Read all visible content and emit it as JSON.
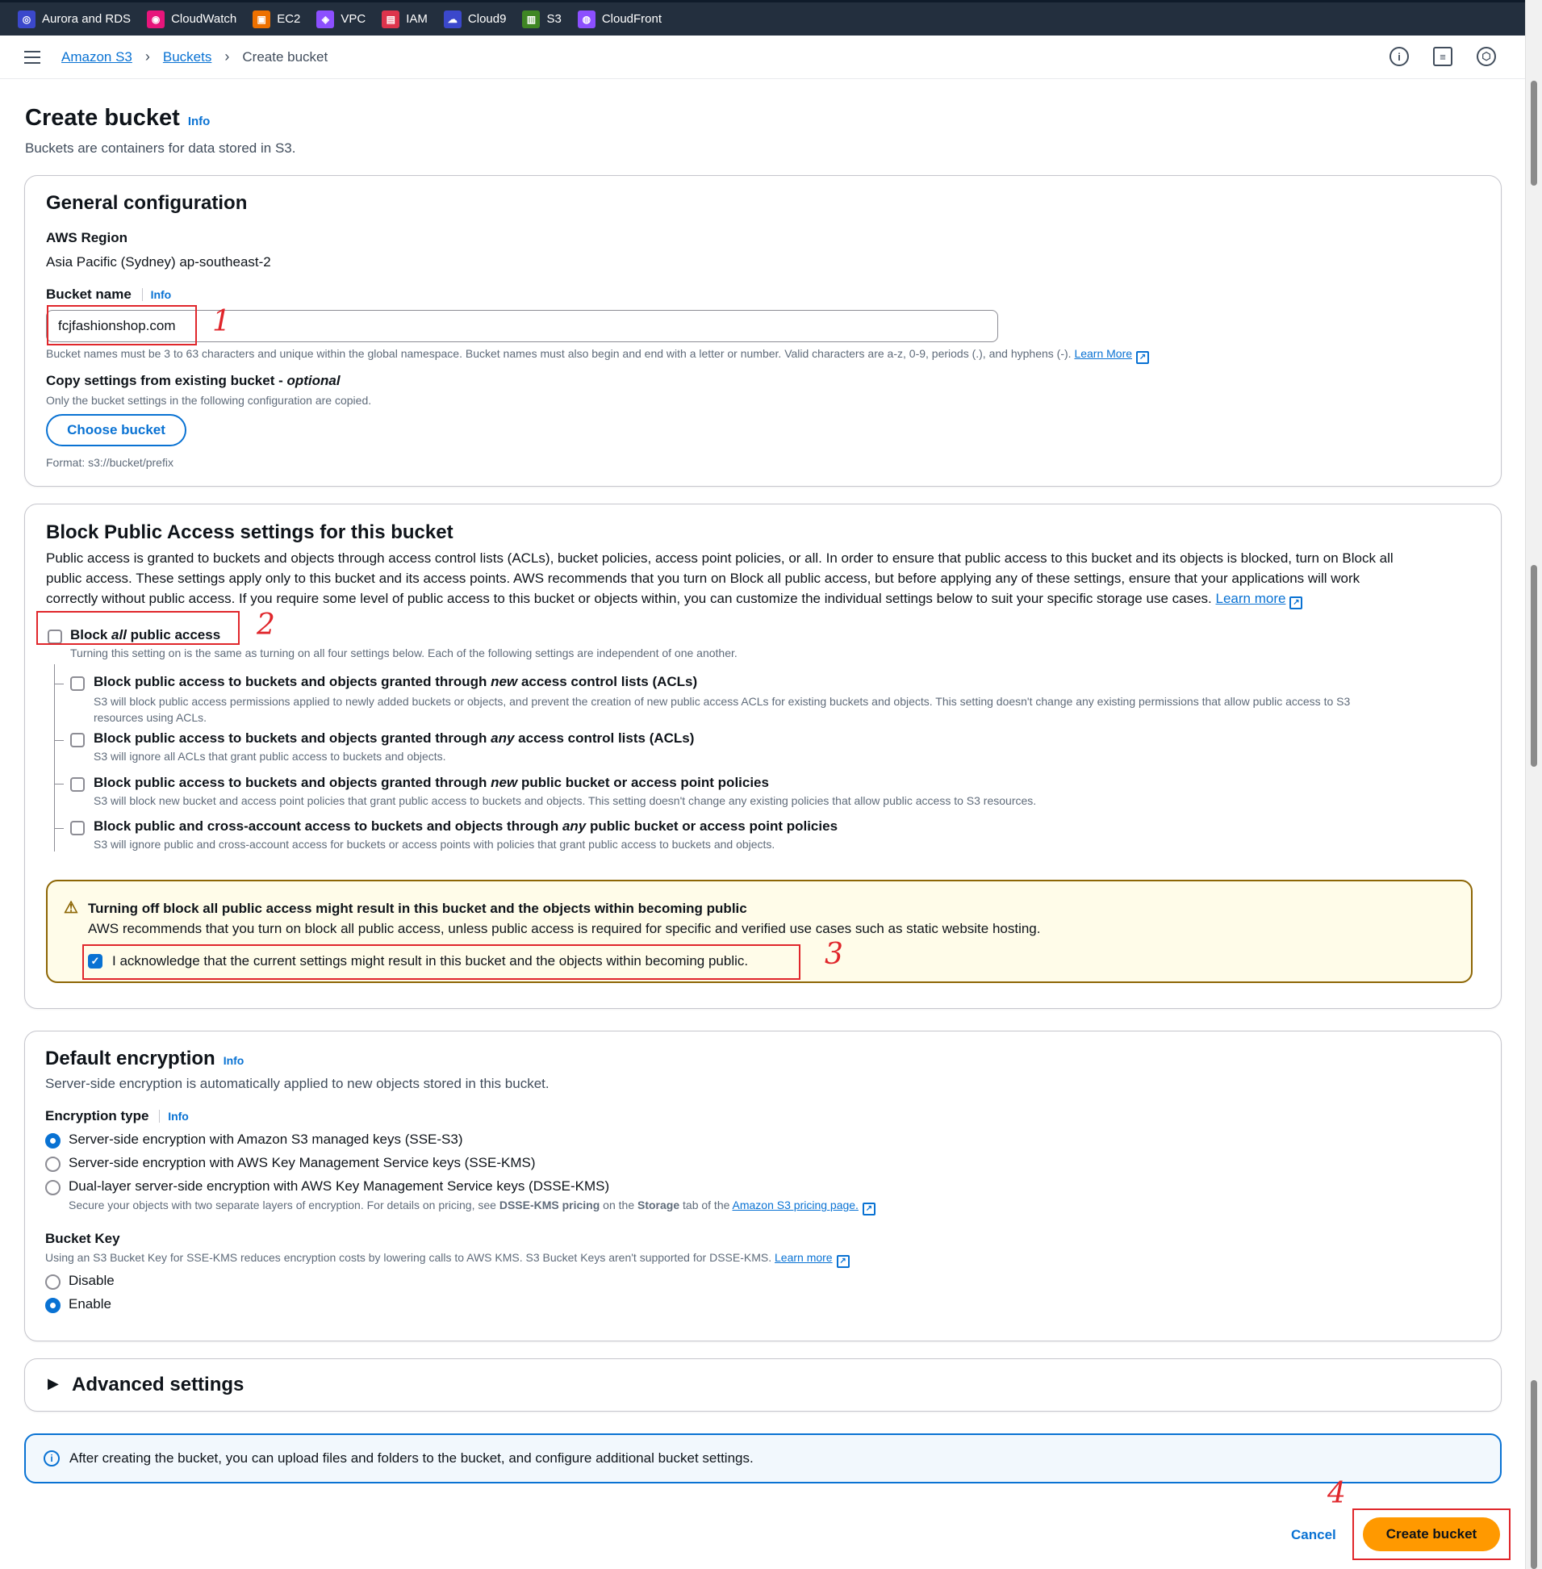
{
  "services": [
    {
      "label": "Aurora and RDS",
      "color": "#3b48cc",
      "glyph": "◎"
    },
    {
      "label": "CloudWatch",
      "color": "#e7157b",
      "glyph": "◉"
    },
    {
      "label": "EC2",
      "color": "#ed7100",
      "glyph": "▣"
    },
    {
      "label": "VPC",
      "color": "#8c4fff",
      "glyph": "◈"
    },
    {
      "label": "IAM",
      "color": "#dd344c",
      "glyph": "▤"
    },
    {
      "label": "Cloud9",
      "color": "#3b48cc",
      "glyph": "☁"
    },
    {
      "label": "S3",
      "color": "#3f8624",
      "glyph": "▥"
    },
    {
      "label": "CloudFront",
      "color": "#8c4fff",
      "glyph": "◍"
    }
  ],
  "breadcrumb": {
    "root": "Amazon S3",
    "parent": "Buckets",
    "current": "Create bucket"
  },
  "page": {
    "title": "Create bucket",
    "info": "Info",
    "subtitle": "Buckets are containers for data stored in S3."
  },
  "general": {
    "title": "General configuration",
    "region_label": "AWS Region",
    "region_value": "Asia Pacific (Sydney) ap-southeast-2",
    "bucket_name_label": "Bucket name",
    "info": "Info",
    "bucket_name_value": "fcjfashionshop.com",
    "bucket_name_help": "Bucket names must be 3 to 63 characters and unique within the global namespace. Bucket names must also begin and end with a letter or number. Valid characters are a-z, 0-9, periods (.), and hyphens (-).",
    "learn_more": "Learn More",
    "copy_label": "Copy settings from existing bucket - ",
    "copy_optional": "optional",
    "copy_desc": "Only the bucket settings in the following configuration are copied.",
    "choose_bucket": "Choose bucket",
    "format": "Format: s3://bucket/prefix"
  },
  "bpa": {
    "title": "Block Public Access settings for this bucket",
    "desc1": "Public access is granted to buckets and objects through access control lists (ACLs), bucket policies, access point policies, or all. In order to ensure that public access to this bucket and its objects is blocked, turn on Block all",
    "desc2": "public access. These settings apply only to this bucket and its access points. AWS recommends that you turn on Block all public access, but before applying any of these settings, ensure that your applications will work",
    "desc3": "correctly without public access. If you require some level of public access to this bucket or objects within, you can customize the individual settings below to suit your specific storage use cases.",
    "learn_more": "Learn more",
    "block_all_pre": "Block ",
    "block_all_em": "all",
    "block_all_post": " public access",
    "block_all_desc": "Turning this setting on is the same as turning on all four settings below. Each of the following settings are independent of one another.",
    "options": [
      {
        "pre": "Block public access to buckets and objects granted through ",
        "em": "new",
        "post": " access control lists (ACLs)",
        "desc": "S3 will block public access permissions applied to newly added buckets or objects, and prevent the creation of new public access ACLs for existing buckets and objects. This setting doesn't change any existing permissions that allow public access to S3",
        "desc2": "resources using ACLs."
      },
      {
        "pre": "Block public access to buckets and objects granted through ",
        "em": "any",
        "post": " access control lists (ACLs)",
        "desc": "S3 will ignore all ACLs that grant public access to buckets and objects.",
        "desc2": ""
      },
      {
        "pre": "Block public access to buckets and objects granted through ",
        "em": "new",
        "post": " public bucket or access point policies",
        "desc": "S3 will block new bucket and access point policies that grant public access to buckets and objects. This setting doesn't change any existing policies that allow public access to S3 resources.",
        "desc2": ""
      },
      {
        "pre": "Block public and cross-account access to buckets and objects through ",
        "em": "any",
        "post": " public bucket or access point policies",
        "desc": "S3 will ignore public and cross-account access for buckets or access points with policies that grant public access to buckets and objects.",
        "desc2": ""
      }
    ],
    "warn_title": "Turning off block all public access might result in this bucket and the objects within becoming public",
    "warn_desc": "AWS recommends that you turn on block all public access, unless public access is required for specific and verified use cases such as static website hosting.",
    "ack": "I acknowledge that the current settings might result in this bucket and the objects within becoming public."
  },
  "encryption": {
    "title": "Default encryption",
    "info": "Info",
    "desc": "Server-side encryption is automatically applied to new objects stored in this bucket.",
    "type_label": "Encryption type",
    "opt1": "Server-side encryption with Amazon S3 managed keys (SSE-S3)",
    "opt2": "Server-side encryption with AWS Key Management Service keys (SSE-KMS)",
    "opt3": "Dual-layer server-side encryption with AWS Key Management Service keys (DSSE-KMS)",
    "opt3_desc_a": "Secure your objects with two separate layers of encryption. For details on pricing, see ",
    "opt3_desc_b": "DSSE-KMS pricing",
    "opt3_desc_c": " on the ",
    "opt3_desc_d": "Storage",
    "opt3_desc_e": " tab of the ",
    "pricing_link": "Amazon S3 pricing page.",
    "key_label": "Bucket Key",
    "key_desc": "Using an S3 Bucket Key for SSE-KMS reduces encryption costs by lowering calls to AWS KMS. S3 Bucket Keys aren't supported for DSSE-KMS.",
    "learn_more": "Learn more",
    "disable": "Disable",
    "enable": "Enable"
  },
  "advanced": {
    "title": "Advanced settings"
  },
  "info_alert": "After creating the bucket, you can upload files and folders to the bucket, and configure additional bucket settings.",
  "footer": {
    "cancel": "Cancel",
    "create": "Create bucket"
  },
  "annotations": [
    "1",
    "2",
    "3",
    "4"
  ]
}
